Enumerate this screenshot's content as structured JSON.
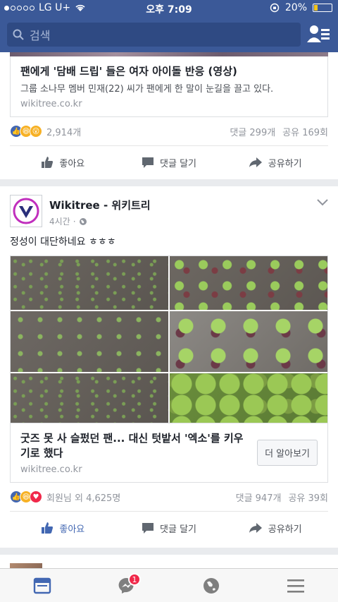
{
  "status_bar": {
    "carrier": "LG U+",
    "time": "오후 7:09",
    "battery": "20%",
    "battery_level": 0.2
  },
  "nav": {
    "search_placeholder": "검색",
    "search_icon": "search-icon",
    "friends_icon": "friend-requests-icon"
  },
  "post1": {
    "link_title": "팬에게 '담배 드립' 들은 여자 아이돌 반응 (영상)",
    "link_desc": "그룹 소나무 멤버 민재(22) 씨가 팬에게 한 말이 눈길을 끌고 있다.",
    "link_domain": "wikitree.co.kr",
    "reaction_count": "2,914개",
    "comments": "댓글 299개",
    "shares": "공유 169회",
    "like_label": "좋아요",
    "comment_label": "댓글 달기",
    "share_label": "공유하기"
  },
  "post2": {
    "page_name": "Wikitree - 위키트리",
    "time": "4시간",
    "text": "정성이 대단하네요 ㅎㅎㅎ",
    "link_title": "굿즈 못 사 슬펐던 팬... 대신 텃밭서 '엑소'를 키우기로 했다",
    "link_domain": "wikitree.co.kr",
    "cta_label": "더 알아보기",
    "reaction_text": "회원님 외 4,625명",
    "comments": "댓글 947개",
    "shares": "공유 39회",
    "like_label": "좋아요",
    "comment_label": "댓글 달기",
    "share_label": "공유하기"
  },
  "tabs": {
    "messenger_badge": "1"
  },
  "colors": {
    "brand": "#3b5998",
    "active_like": "#4267b2",
    "badge": "#f02849"
  }
}
